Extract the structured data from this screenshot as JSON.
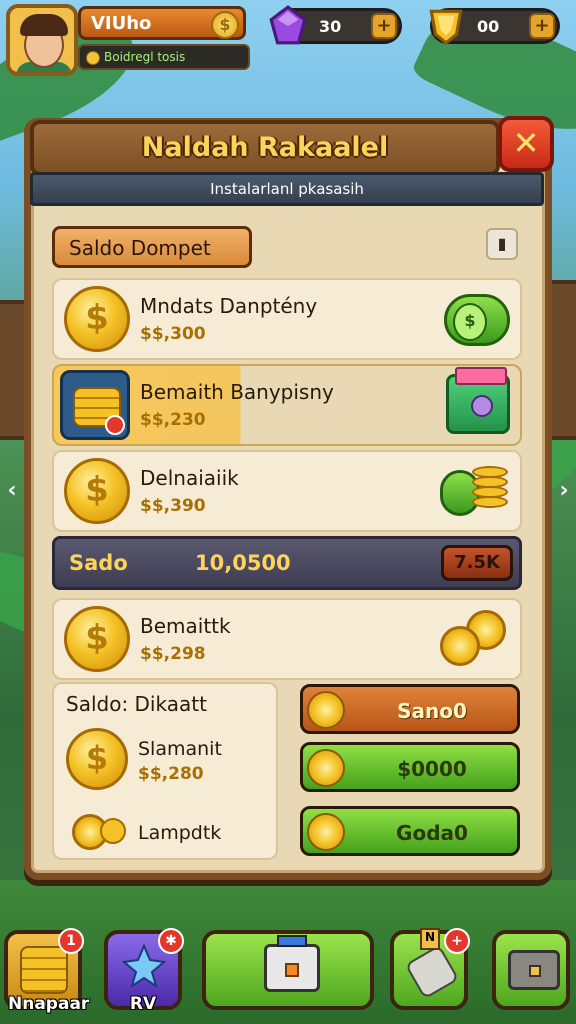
{
  "topbar": {
    "player_name": "VIUho",
    "player_sub": "Boidregl tosis",
    "gem_value": "30",
    "gold_value": "00",
    "plus": "+"
  },
  "dialog": {
    "title": "Naldah Rakaalel",
    "subtitle": "Instalarlanl pkasasih",
    "close": "✕",
    "section_label": "Saldo Dompet",
    "info_icon": "▮"
  },
  "rows": [
    {
      "name": "Mndats Danptény",
      "price": "$$,300",
      "icon": "cash-icon"
    },
    {
      "name": "Bemaith Banypisny",
      "price": "$$,230",
      "icon": "chest-icon"
    },
    {
      "name": "Delnaiaiik",
      "price": "$$,390",
      "icon": "coin-stack-icon"
    }
  ],
  "saldo": {
    "label": "Sado",
    "amount": "10,0500",
    "chip": "7.5K"
  },
  "row4": {
    "name": "Bemaittk",
    "price": "$$,298"
  },
  "left_card": {
    "header": "Saldo: Dikaatt",
    "item_name": "Slamanit",
    "item_price": "$$,280",
    "footer": "Lampdtk"
  },
  "buy_buttons": [
    "Sano0",
    "$0000",
    "Goda0"
  ],
  "coin_symbol": "$",
  "nav_arrows": {
    "left": "‹",
    "right": "›"
  },
  "bottom_nav": {
    "item1": {
      "label": "Nnapaar",
      "badge": "1"
    },
    "item2": {
      "label": "RV",
      "badge": "✱"
    },
    "item4": {
      "badge_text": "N",
      "badge": "+"
    }
  },
  "colors": {
    "accent_gold": "#fdd35a",
    "wood": "#7b4e24",
    "green": "#45a21c",
    "red": "#c72a16"
  }
}
